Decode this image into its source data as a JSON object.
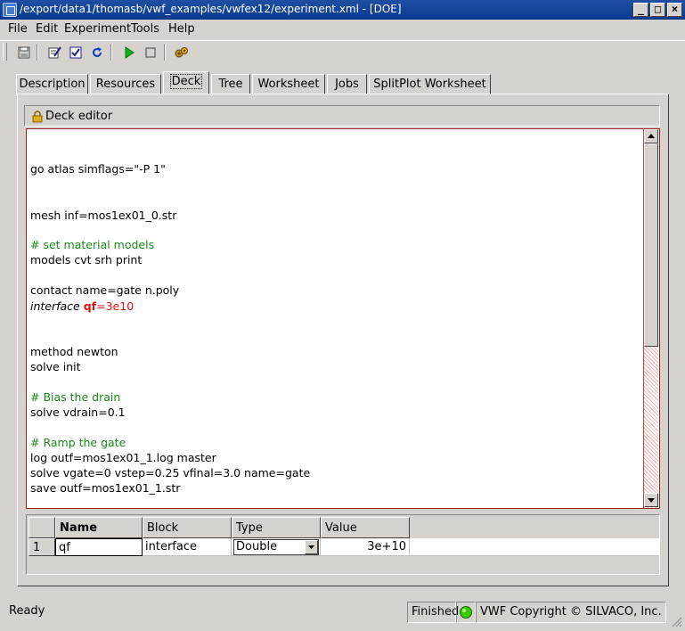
{
  "window": {
    "title": "/export/data1/thomasb/vwf_examples/vwfex12/experiment.xml - [DOE]",
    "minimize_glyph": "_",
    "maximize_glyph": "□",
    "close_glyph": "×"
  },
  "menu": [
    "File",
    "Edit",
    "Experiment",
    "Tools",
    "Help"
  ],
  "toolbar": {
    "icons": [
      "save-icon",
      "edit-icon",
      "check-icon",
      "refresh-icon",
      "run-icon",
      "stop-icon",
      "tools-icon"
    ]
  },
  "tabs": [
    {
      "label": "Description",
      "active": false
    },
    {
      "label": "Resources",
      "active": false
    },
    {
      "label": "Deck",
      "active": true
    },
    {
      "label": "Tree",
      "active": false
    },
    {
      "label": "Worksheet",
      "active": false
    },
    {
      "label": "Jobs",
      "active": false
    },
    {
      "label": "SplitPlot Worksheet",
      "active": false
    }
  ],
  "deck_editor": {
    "header": "Deck editor",
    "lines": {
      "l1": "go atlas simflags=\"-P 1\"",
      "l2": "mesh inf=mos1ex01_0.str",
      "l3": "# set material models",
      "l4": "models cvt srh print",
      "l5": "contact name=gate n.poly",
      "l6_kw": "interface ",
      "l6_param": "qf",
      "l6_eq": "=",
      "l6_val": "3e10",
      "l7": "method newton",
      "l8": "solve init",
      "l9": "# Bias the drain",
      "l10": "solve vdrain=0.1",
      "l11": "# Ramp the gate",
      "l12": "log outf=mos1ex01_1.log master",
      "l13": "solve vgate=0 vstep=0.25 vfinal=3.0 name=gate",
      "l14": "save outf=mos1ex01_1.str"
    }
  },
  "table": {
    "headers": {
      "name": "Name",
      "block": "Block",
      "type": "Type",
      "value": "Value"
    },
    "row": {
      "index": "1",
      "name": "qf",
      "block": "interface",
      "type": "Double",
      "value": "3e+10"
    }
  },
  "status": {
    "ready": "Ready",
    "finished": "Finished",
    "copyright": "VWF Copyright ©  SILVACO, Inc.",
    "indicator_color": "#33cc00"
  },
  "colors": {
    "comment": "#1a8a1a",
    "parameter": "#e01010",
    "editor_border": "#a02020"
  }
}
